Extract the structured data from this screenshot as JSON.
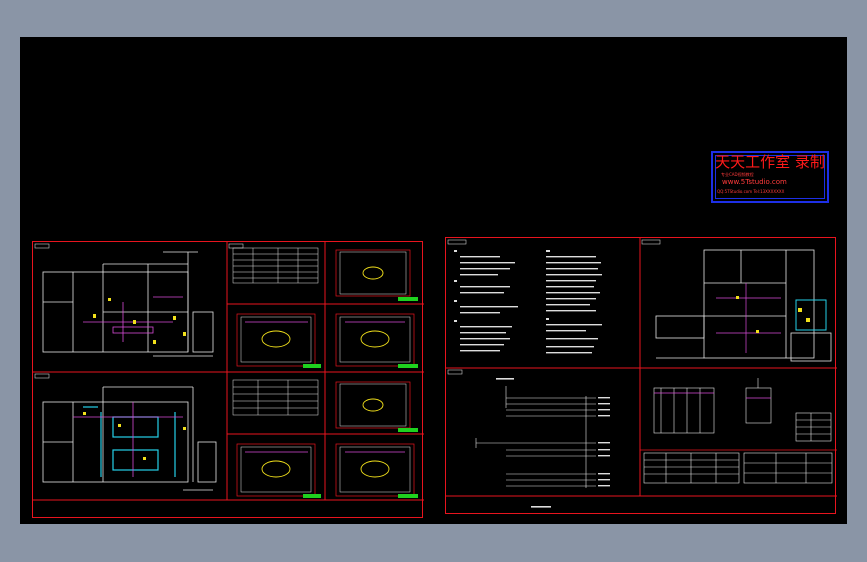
{
  "watermark": {
    "title": "天天工作室 录制",
    "subtitle": "专业CAD视频教程",
    "url": "www.5Tstudio.com",
    "contact": "QQ:5TStudio.com  Tel:13XXXXXXX"
  },
  "colors": {
    "background": "#8a95a6",
    "canvas": "#000000",
    "frame": "#e8141e",
    "stamp_border": "#1d2fe6",
    "stamp_text": "#ff1a1a"
  }
}
